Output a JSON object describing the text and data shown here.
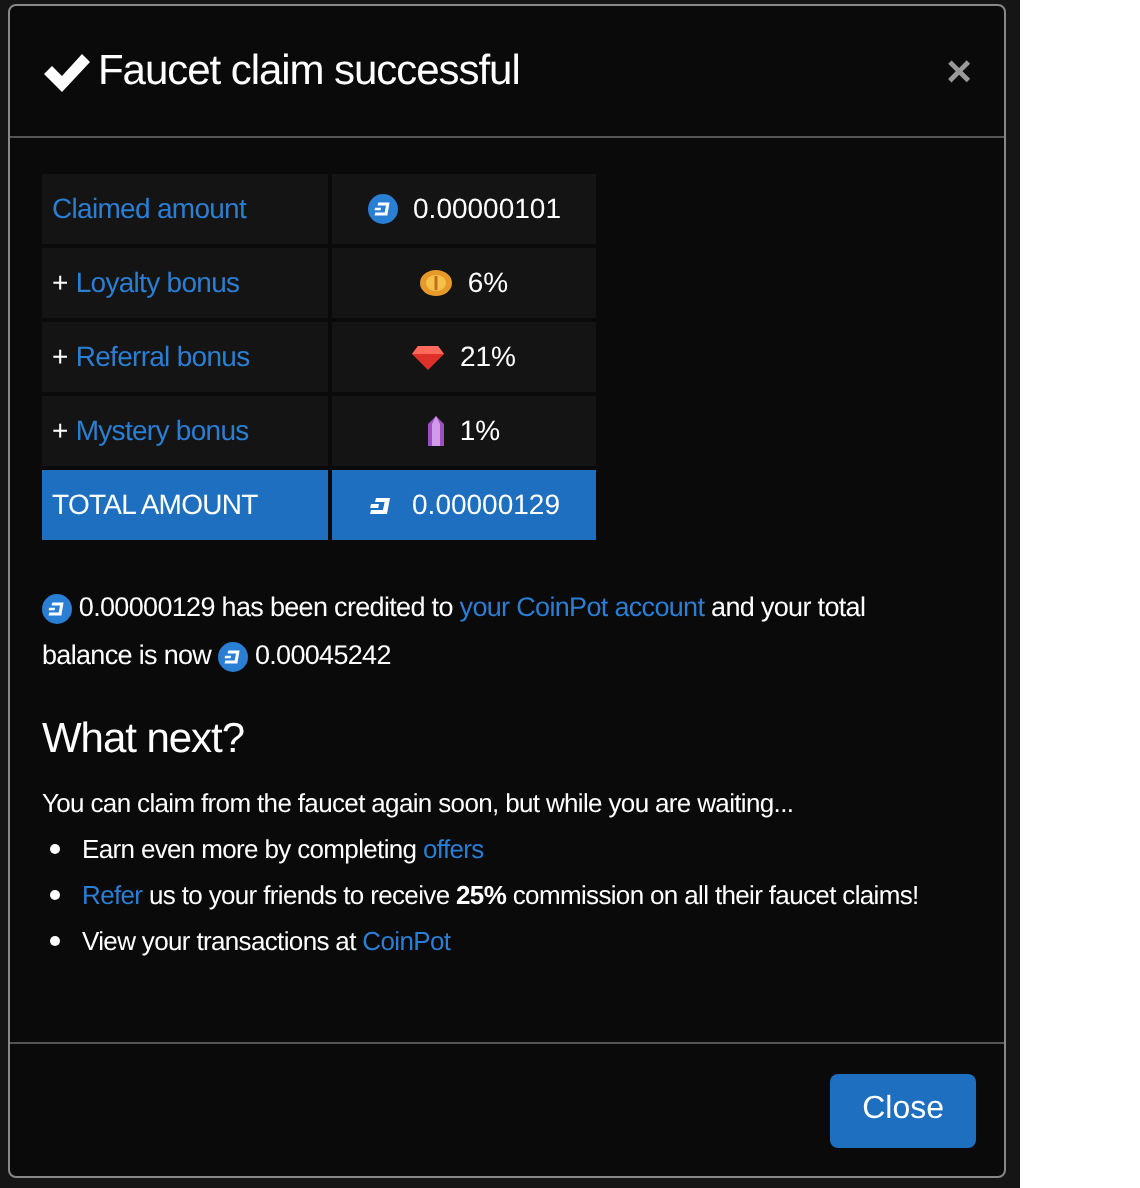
{
  "modal": {
    "title": "Faucet claim successful",
    "close_symbol": "×",
    "rows": [
      {
        "kind": "plain",
        "label": "Claimed amount",
        "value": "0.00000101"
      },
      {
        "kind": "bonus",
        "prefix": "+",
        "label": "Loyalty bonus",
        "value": "6%"
      },
      {
        "kind": "bonus",
        "prefix": "+",
        "label": "Referral bonus",
        "value": "21%"
      },
      {
        "kind": "bonus",
        "prefix": "+",
        "label": "Mystery bonus",
        "value": "1%"
      },
      {
        "kind": "total",
        "label": "TOTAL AMOUNT",
        "value": "0.00000129"
      }
    ],
    "credit": [
      {
        "kind": "dash"
      },
      {
        "kind": "text",
        "text": "0.00000129 has been credited to"
      },
      {
        "kind": "link",
        "text": "your CoinPot account"
      },
      {
        "kind": "text",
        "text": "and your total balance is now"
      },
      {
        "kind": "dash"
      },
      {
        "kind": "text",
        "text": "0.00045242"
      }
    ],
    "heading": "What next?",
    "intro": "You can claim from the faucet again soon, but while you are waiting...",
    "bullets": [
      [
        {
          "kind": "text",
          "text": "Earn even more by completing"
        },
        {
          "kind": "link",
          "text": "offers"
        }
      ],
      [
        {
          "kind": "link",
          "text": "Refer"
        },
        {
          "kind": "text",
          "text": "us to your friends to receive **25%** commission on all their faucet claims!"
        }
      ],
      [
        {
          "kind": "text",
          "text": "View your transactions at"
        },
        {
          "kind": "link",
          "text": "CoinPot"
        }
      ]
    ],
    "button": "Close"
  }
}
